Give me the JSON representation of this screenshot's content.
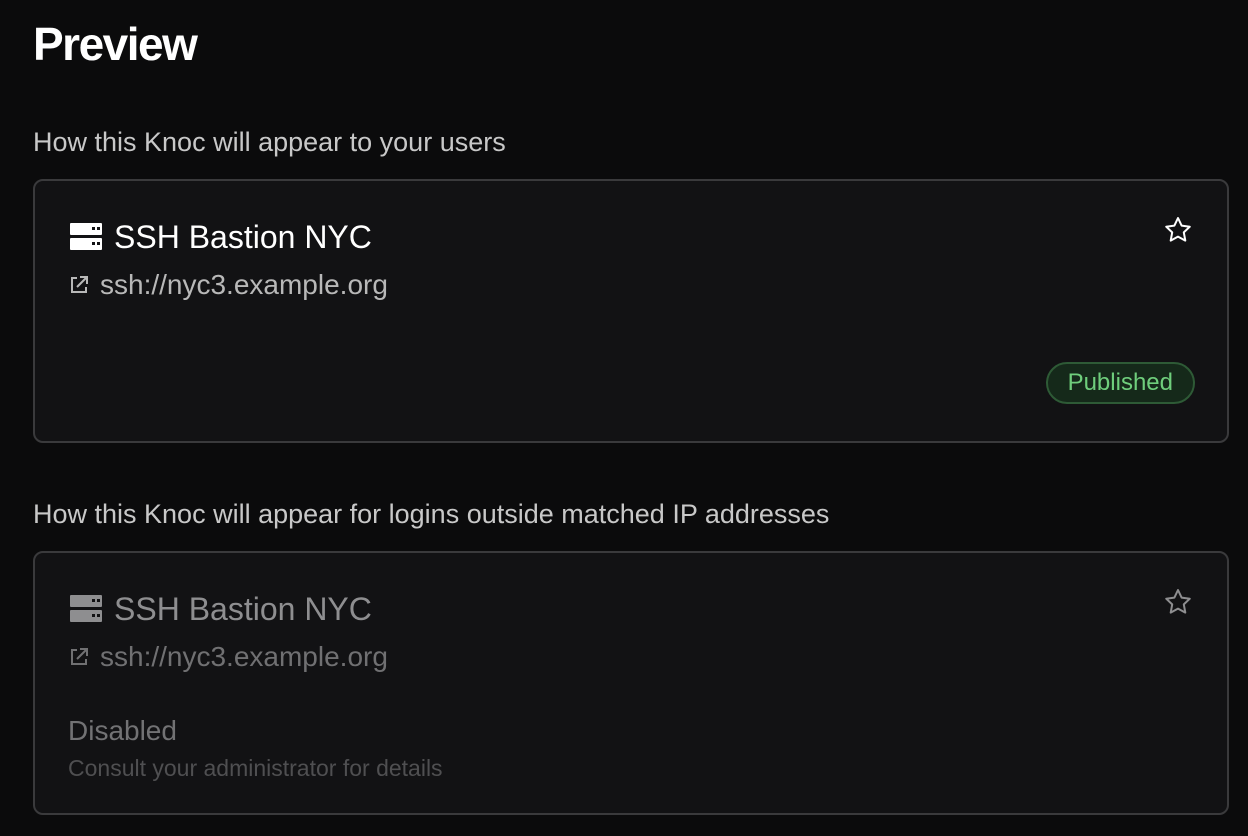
{
  "page": {
    "title": "Preview"
  },
  "sections": [
    {
      "caption": "How this Knoc will appear to your users",
      "card": {
        "icon": "server-icon",
        "title": "SSH Bastion NYC",
        "url_icon": "external-link-icon",
        "url": "ssh://nyc3.example.org",
        "favorite_icon": "star-icon",
        "status": "Published",
        "status_color": "#6fce7c"
      }
    },
    {
      "caption": "How this Knoc will appear for logins outside matched IP addresses",
      "card": {
        "icon": "server-icon",
        "title": "SSH Bastion NYC",
        "url_icon": "external-link-icon",
        "url": "ssh://nyc3.example.org",
        "favorite_icon": "star-icon",
        "disabled_label": "Disabled",
        "disabled_message": "Consult your administrator for details"
      }
    }
  ],
  "colors": {
    "background": "#0b0b0c",
    "card_background": "#121214",
    "card_border": "#3a3a3c",
    "published_green": "#6fce7c"
  }
}
